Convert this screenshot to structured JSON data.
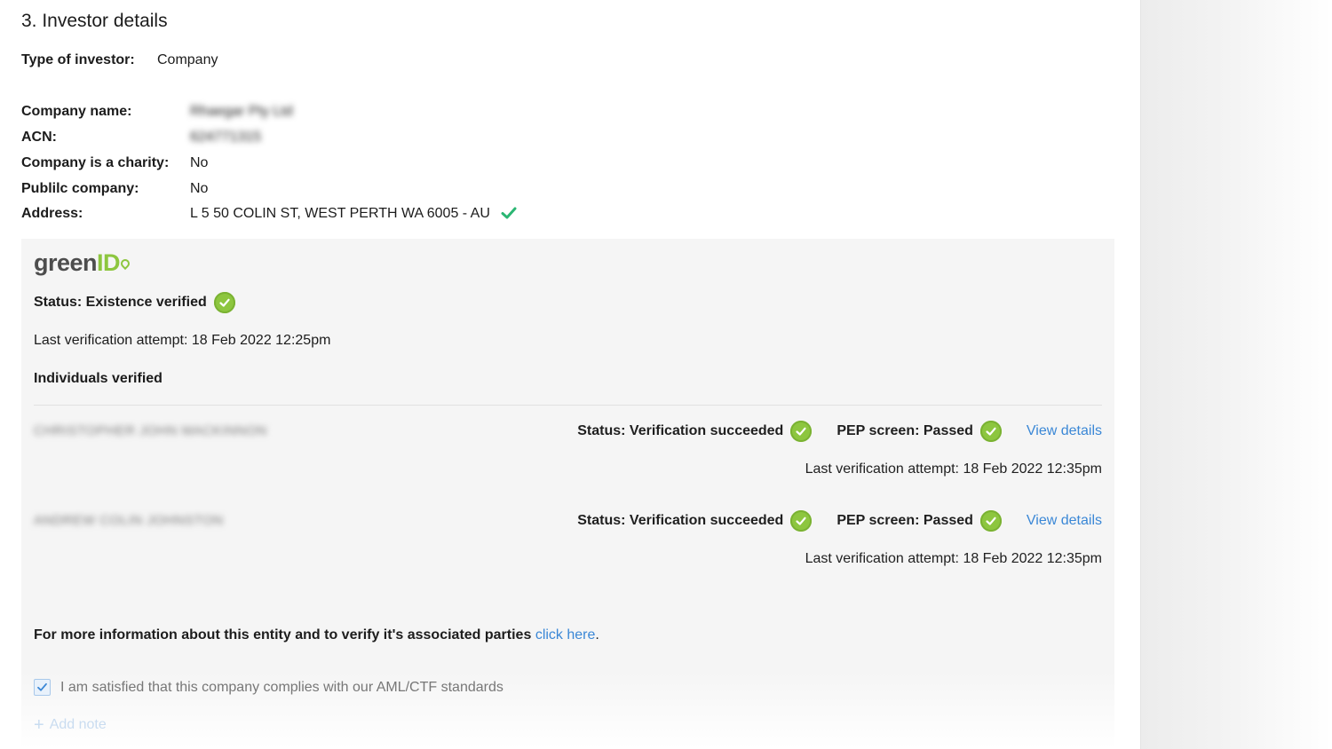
{
  "section": {
    "title": "3. Investor details"
  },
  "investor_type": {
    "label": "Type of investor:",
    "value": "Company"
  },
  "company": {
    "name_label": "Company name:",
    "name_value": "Rhaegar Pty Ltd",
    "acn_label": "ACN:",
    "acn_value": "624771315",
    "charity_label": "Company is a charity:",
    "charity_value": "No",
    "public_label": "Publilc company:",
    "public_value": "No",
    "address_label": "Address:",
    "address_value": "L 5 50 COLIN ST, WEST PERTH WA 6005 - AU"
  },
  "greenid": {
    "logo_dark": "green",
    "logo_accent": "ID",
    "status": "Status: Existence verified",
    "last_attempt": "Last verification attempt: 18 Feb 2022 12:25pm",
    "individuals_heading": "Individuals verified",
    "individuals": [
      {
        "name": "CHRISTOPHER JOHN MACKINNON",
        "status": "Status: Verification succeeded",
        "pep": "PEP screen: Passed",
        "link": "View details",
        "last_attempt": "Last verification attempt: 18 Feb 2022 12:35pm"
      },
      {
        "name": "ANDREW COLIN JOHNSTON",
        "status": "Status: Verification succeeded",
        "pep": "PEP screen: Passed",
        "link": "View details",
        "last_attempt": "Last verification attempt: 18 Feb 2022 12:35pm"
      }
    ],
    "more_info_text": "For more information about this entity and to verify it's associated parties ",
    "more_info_link": "click here",
    "more_info_end": ".",
    "compliance_checkbox": {
      "label": "I am satisfied that this company complies with our AML/CTF standards",
      "checked": true
    },
    "add_note": "Add note"
  },
  "colors": {
    "accent_green": "#8dc63f",
    "link_blue": "#3a87d6",
    "check_green": "#2bb673"
  }
}
